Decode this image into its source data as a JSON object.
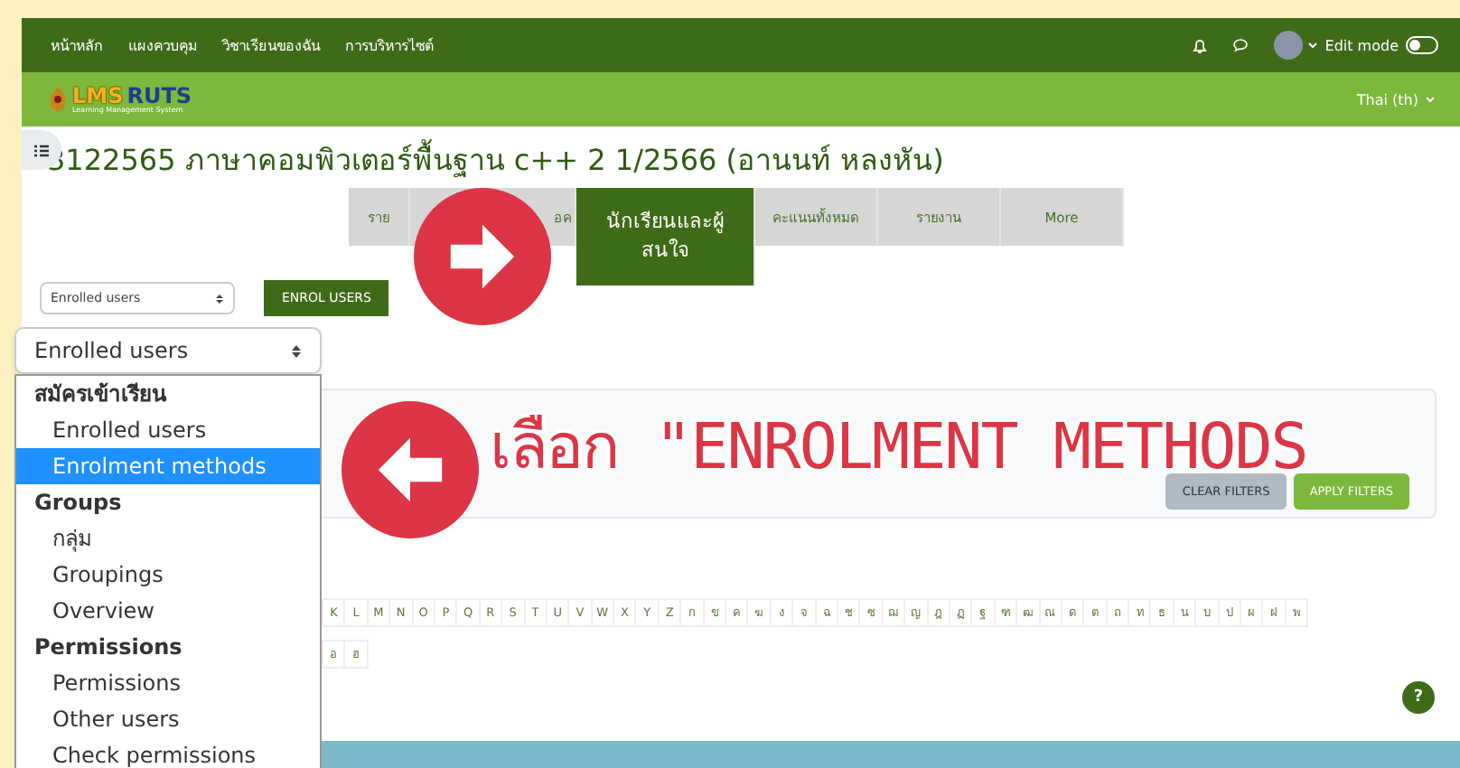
{
  "nav": {
    "links": [
      "หน้าหลัก",
      "แผงควบคุม",
      "วิชาเรียนของฉัน",
      "การบริหารไซต์"
    ],
    "edit_mode": {
      "label": "Edit mode",
      "on": false
    }
  },
  "brand": {
    "logo_left": "LMS",
    "logo_right": "RUTS",
    "tagline": "Learning Management System"
  },
  "language": "Thai (th)",
  "course_title": "3122565 ภาษาคอมพิวเตอร์พื้นฐาน c++ 2 1/2566 (อานนท์ หลงหัน)",
  "tabs": [
    {
      "label": "ราย",
      "selected": false
    },
    {
      "label": "อค",
      "selected": false
    },
    {
      "label": "นักเรียนและผู้สนใจ",
      "selected": true
    },
    {
      "label": "คะแนนทั้งหมด",
      "selected": false
    },
    {
      "label": "รายงาน",
      "selected": false
    },
    {
      "label": "More",
      "selected": false
    }
  ],
  "participants_select": "Enrolled users",
  "enrol_button": "ENROL USERS",
  "filters": {
    "clear": "CLEAR FILTERS",
    "apply": "APPLY FILTERS"
  },
  "initials_row": [
    "K",
    "L",
    "M",
    "N",
    "O",
    "P",
    "Q",
    "R",
    "S",
    "T",
    "U",
    "V",
    "W",
    "X",
    "Y",
    "Z",
    "ก",
    "ข",
    "ค",
    "ฆ",
    "ง",
    "จ",
    "ฉ",
    "ช",
    "ซ",
    "ฌ",
    "ญ",
    "ฎ",
    "ฏ",
    "ฐ",
    "ฑ",
    "ฒ",
    "ณ",
    "ด",
    "ต",
    "ถ",
    "ท",
    "ธ",
    "น",
    "บ",
    "ป",
    "ผ",
    "ฝ",
    "พ"
  ],
  "initials_row_2": [
    "อ",
    "ฮ"
  ],
  "dropdown": {
    "value": "Enrolled users",
    "groups": [
      {
        "label": "สมัครเข้าเรียน",
        "options": [
          {
            "label": "Enrolled users",
            "selected": false
          },
          {
            "label": "Enrolment methods",
            "selected": true
          }
        ]
      },
      {
        "label": "Groups",
        "options": [
          {
            "label": "กลุ่ม",
            "selected": false
          },
          {
            "label": "Groupings",
            "selected": false
          },
          {
            "label": "Overview",
            "selected": false
          }
        ]
      },
      {
        "label": "Permissions",
        "options": [
          {
            "label": "Permissions",
            "selected": false
          },
          {
            "label": "Other users",
            "selected": false
          },
          {
            "label": "Check permissions",
            "selected": false
          }
        ]
      }
    ]
  },
  "annotation": {
    "text": "เลือก \"ENROLMENT METHODS"
  },
  "help_button": "?"
}
